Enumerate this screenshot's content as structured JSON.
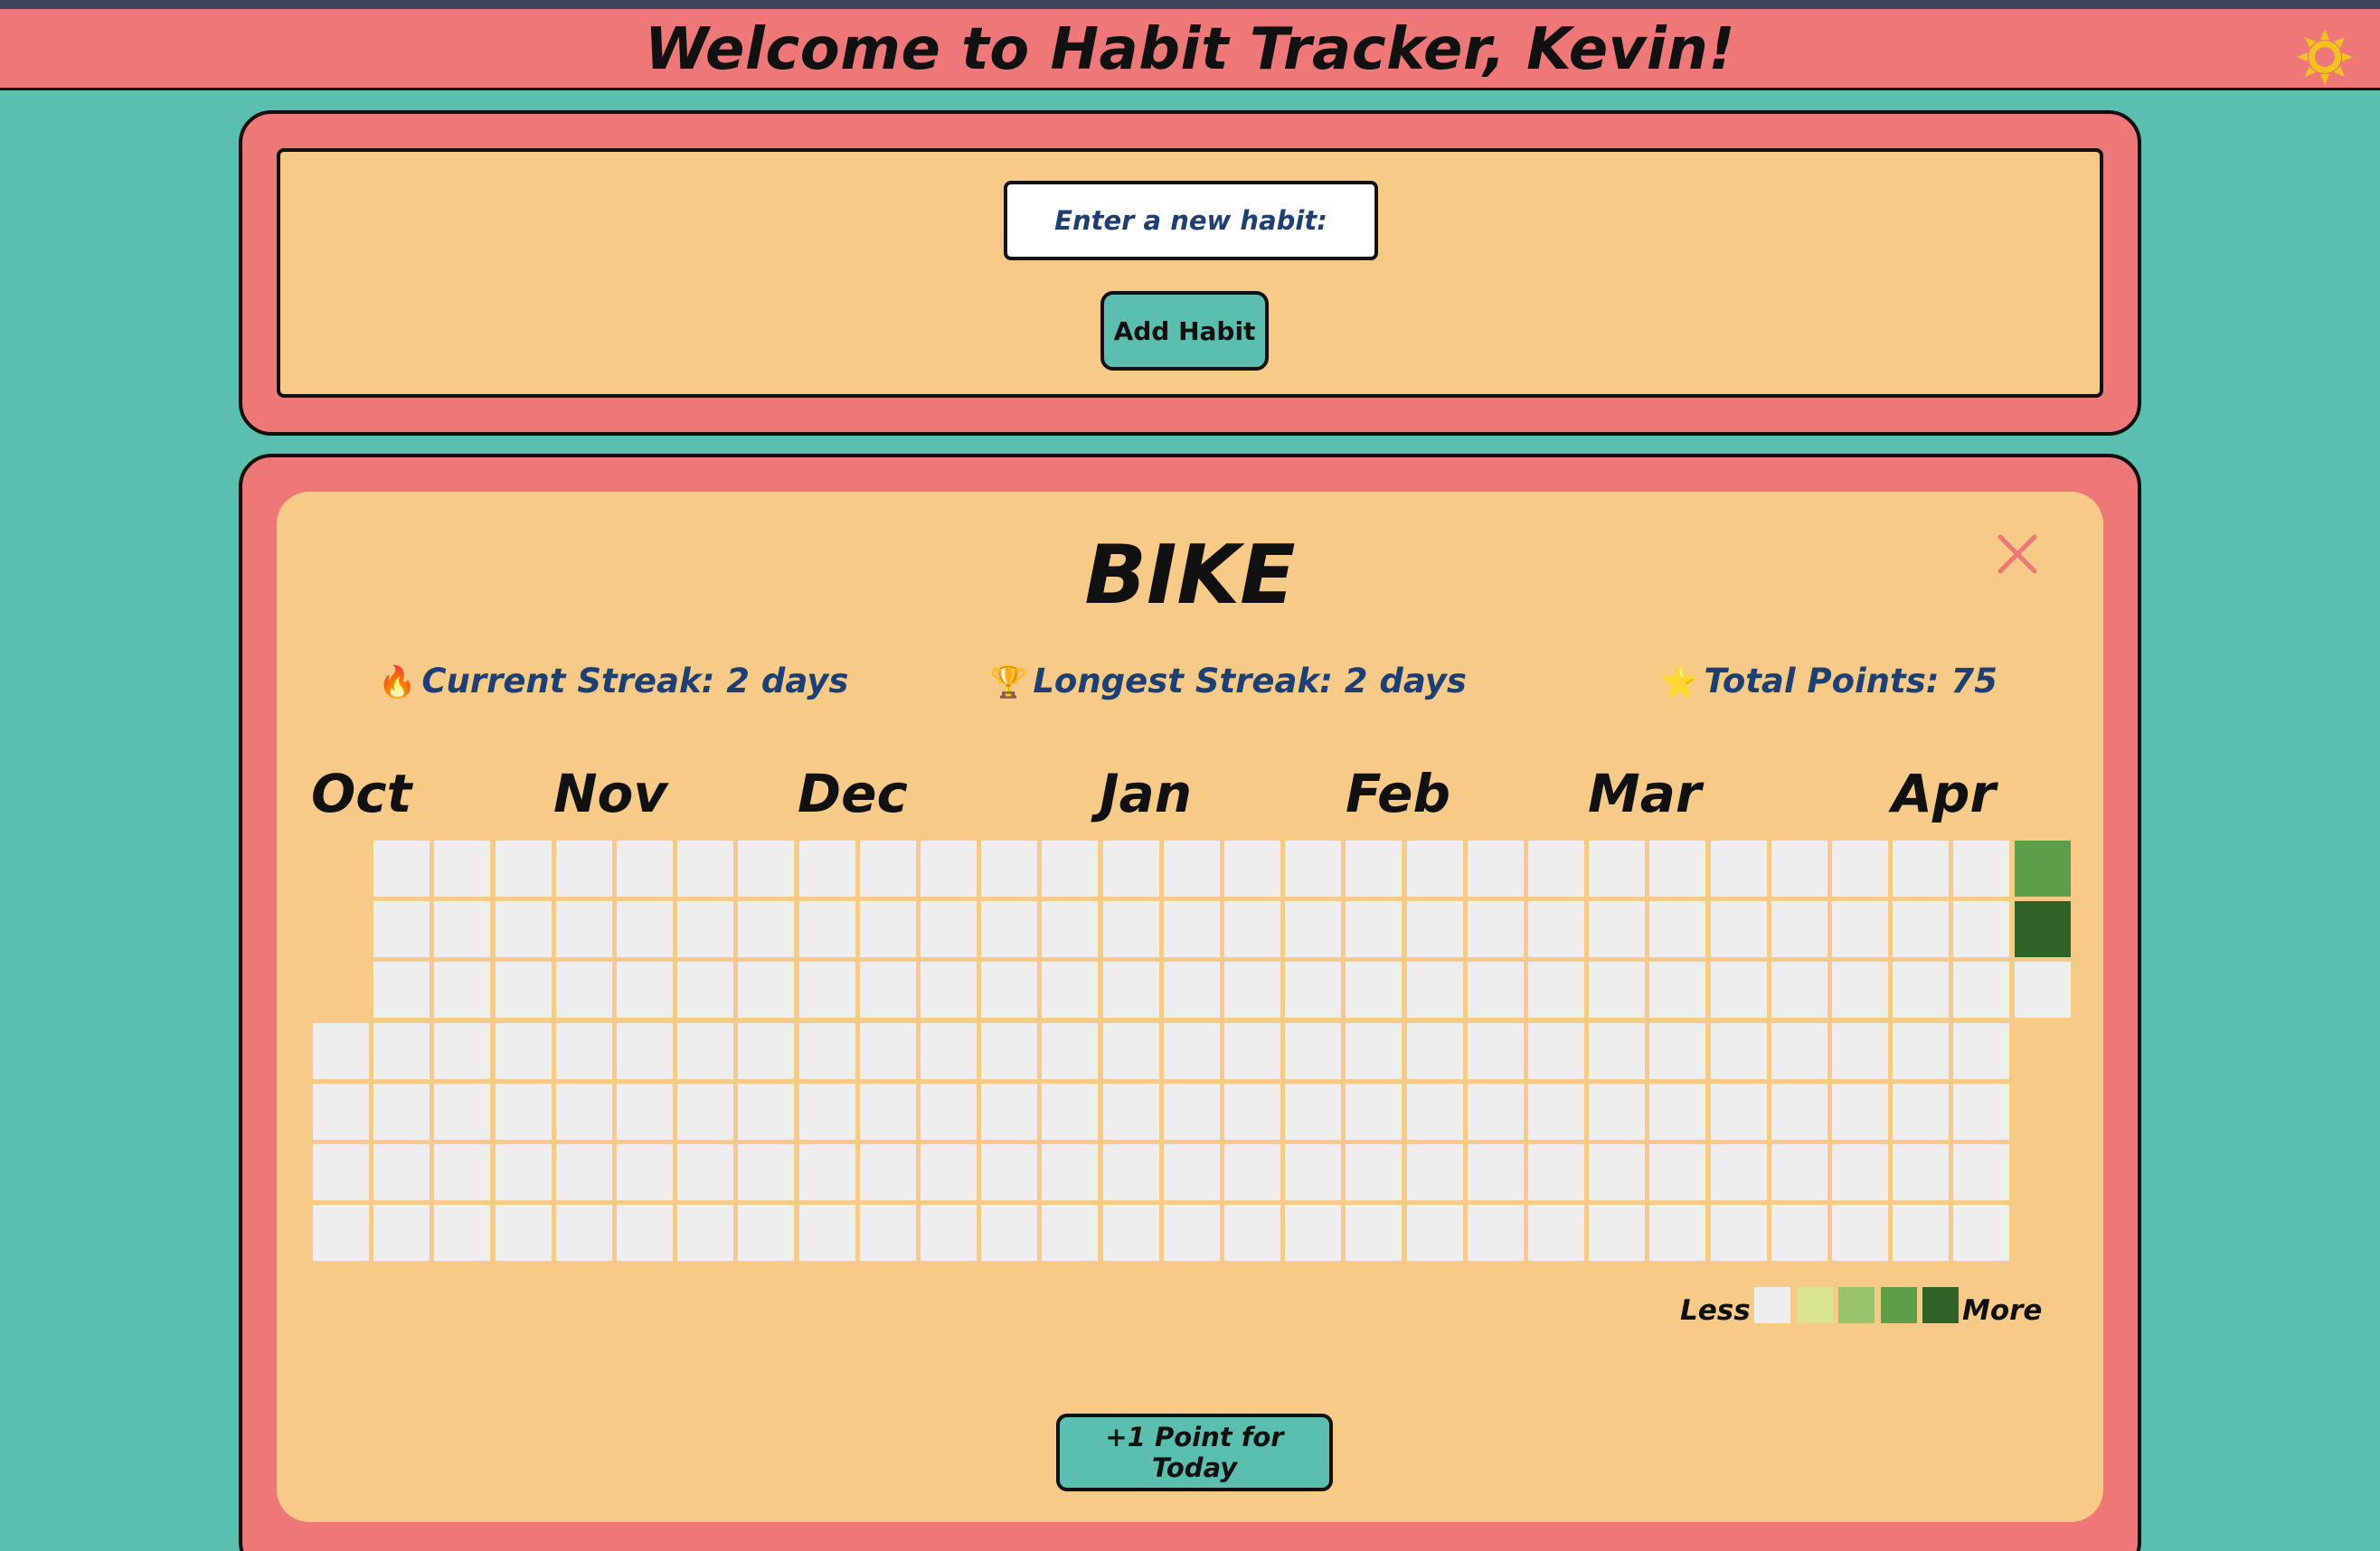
{
  "header": {
    "title": "Welcome to Habit Tracker, Kevin!",
    "theme_icon": "sun-icon"
  },
  "new_habit": {
    "placeholder": "Enter a new habit:",
    "add_button_label": "Add Habit"
  },
  "habit_card": {
    "name": "BIKE",
    "close_icon": "close-icon",
    "stats": {
      "current_streak": {
        "icon": "fire-emoji",
        "label": "Current Streak: 2 days"
      },
      "longest_streak": {
        "icon": "trophy-emoji",
        "label": "Longest Streak: 2 days"
      },
      "total_points": {
        "icon": "star-emoji",
        "label": "Total Points: 75"
      }
    },
    "months": [
      "Oct",
      "Nov",
      "Dec",
      "Jan",
      "Feb",
      "Mar",
      "Apr"
    ],
    "heatmap": {
      "weeks": 29,
      "days_per_week": 7,
      "first_week_start_day": 3,
      "last_week_filled_days": 3,
      "marked_cells": [
        {
          "week": 28,
          "day": 0,
          "level": 3
        },
        {
          "week": 28,
          "day": 1,
          "level": 4
        }
      ]
    },
    "legend": {
      "less_label": "Less",
      "more_label": "More",
      "colors": [
        "#eeeeee",
        "#d8e58e",
        "#99c46b",
        "#5e9e48",
        "#2f6328"
      ]
    },
    "point_button_label": "+1 Point for Today"
  },
  "colors": {
    "background": "#5bbfb0",
    "header": "#ee7777",
    "card": "#f7cb87",
    "text_blue": "#1e3f73",
    "close": "#ee7777"
  }
}
